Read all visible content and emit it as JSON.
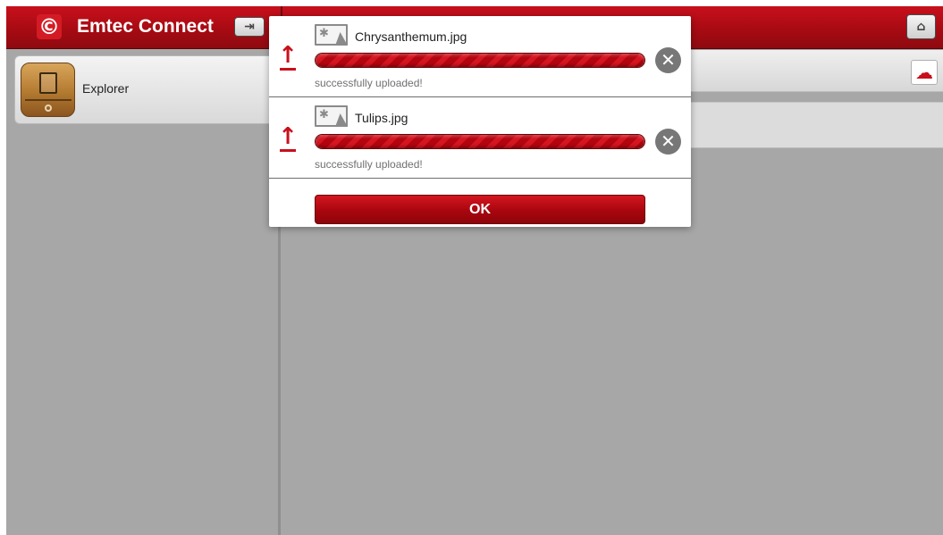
{
  "app": {
    "title": "Emtec Connect",
    "logo_glyph": "©"
  },
  "header": {
    "logout_icon": "logout-icon",
    "home_icon": "home-icon"
  },
  "sidebar": {
    "items": [
      {
        "label": "Explorer",
        "icon": "explorer-drawer-icon"
      }
    ]
  },
  "toolbar": {
    "upload_icon": "cloud-upload-icon"
  },
  "dialog": {
    "uploads": [
      {
        "file_name": "Chrysanthemum.jpg",
        "status": "successfully uploaded!",
        "progress": 1.0
      },
      {
        "file_name": "Tulips.jpg",
        "status": "successfully uploaded!",
        "progress": 1.0
      }
    ],
    "ok_label": "OK"
  },
  "colors": {
    "accent": "#c8101c",
    "background": "#a7a7a7",
    "dialog": "#ffffff"
  }
}
